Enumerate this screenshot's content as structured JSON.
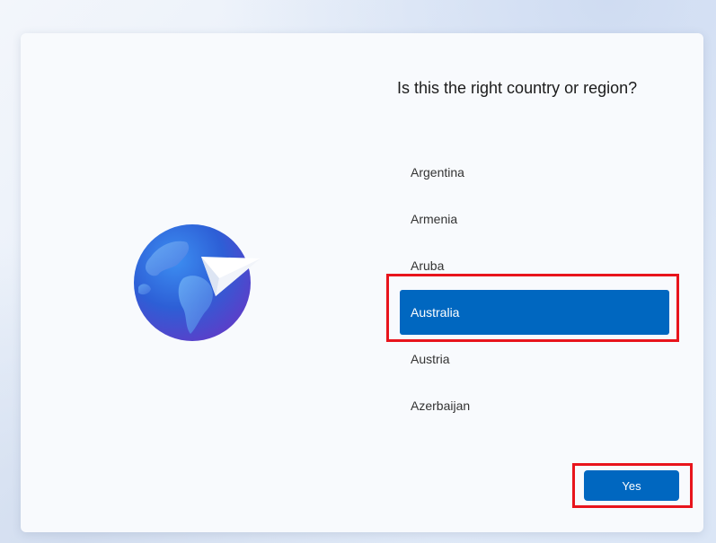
{
  "title": "Is this the right country or region?",
  "countries": [
    {
      "label": "Argentina",
      "selected": false
    },
    {
      "label": "Armenia",
      "selected": false
    },
    {
      "label": "Aruba",
      "selected": false
    },
    {
      "label": "Australia",
      "selected": true
    },
    {
      "label": "Austria",
      "selected": false
    },
    {
      "label": "Azerbaijan",
      "selected": false
    }
  ],
  "yes_label": "Yes",
  "illustration_icon": "globe-with-paper-plane-icon",
  "colors": {
    "accent": "#0067c0",
    "highlight": "#e8141c"
  }
}
